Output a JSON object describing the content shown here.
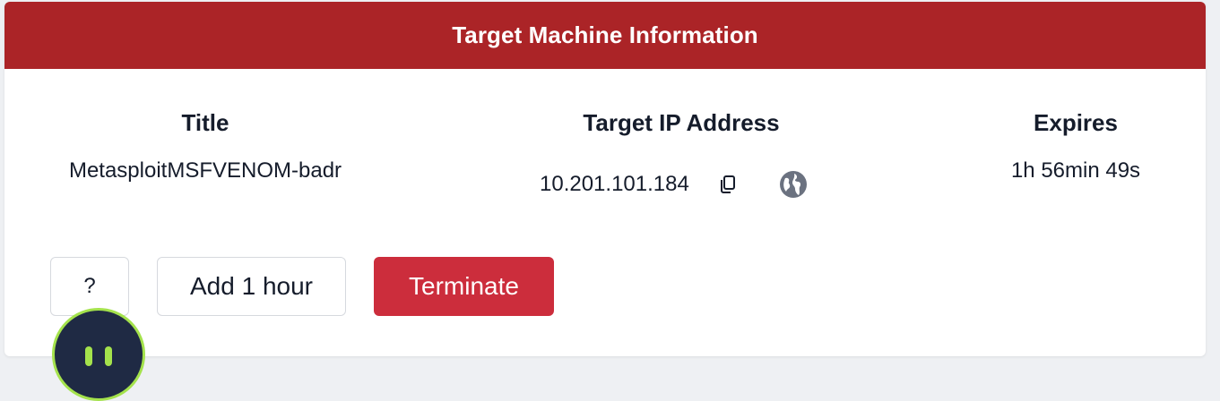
{
  "header": {
    "title": "Target Machine Information",
    "color": "#ab2427"
  },
  "columns": {
    "title": {
      "heading": "Title",
      "value": "MetasploitMSFVENOM-badr"
    },
    "ip": {
      "heading": "Target IP Address",
      "value": "10.201.101.184",
      "icons": [
        "copy-icon",
        "globe-icon"
      ]
    },
    "expires": {
      "heading": "Expires",
      "value": "1h 56min 49s"
    }
  },
  "actions": {
    "help_label": "?",
    "add_label": "Add 1 hour",
    "terminate_label": "Terminate",
    "terminate_color": "#cc2d3c"
  },
  "fab": {
    "icon": "pause-icon",
    "accent": "#a4e24c"
  }
}
